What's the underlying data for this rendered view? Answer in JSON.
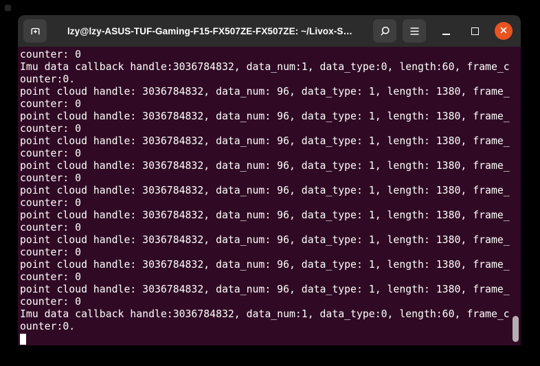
{
  "window": {
    "title": "lzy@lzy-ASUS-TUF-Gaming-F15-FX507ZE-FX507ZE: ~/Livox-S…",
    "titlebar": {
      "icons": {
        "left": "new-tab-icon",
        "right": [
          "search-icon",
          "menu-icon",
          "minimize-icon",
          "maximize-icon",
          "close-icon"
        ]
      }
    },
    "colors": {
      "titlebar_bg": "#2c2c2c",
      "titlebar_button_bg": "#3e3e3e",
      "close_button": "#e95420",
      "terminal_bg": "#300a24",
      "terminal_fg": "#ffffff",
      "scrollbar_thumb": "#b5aeb2",
      "surround": "#000000"
    }
  },
  "terminal": {
    "lines": [
      "counter: 0",
      "Imu data callback handle:3036784832, data_num:1, data_type:0, length:60, frame_c",
      "ounter:0.",
      "point cloud handle: 3036784832, data_num: 96, data_type: 1, length: 1380, frame_",
      "counter: 0",
      "point cloud handle: 3036784832, data_num: 96, data_type: 1, length: 1380, frame_",
      "counter: 0",
      "point cloud handle: 3036784832, data_num: 96, data_type: 1, length: 1380, frame_",
      "counter: 0",
      "point cloud handle: 3036784832, data_num: 96, data_type: 1, length: 1380, frame_",
      "counter: 0",
      "point cloud handle: 3036784832, data_num: 96, data_type: 1, length: 1380, frame_",
      "counter: 0",
      "point cloud handle: 3036784832, data_num: 96, data_type: 1, length: 1380, frame_",
      "counter: 0",
      "point cloud handle: 3036784832, data_num: 96, data_type: 1, length: 1380, frame_",
      "counter: 0",
      "point cloud handle: 3036784832, data_num: 96, data_type: 1, length: 1380, frame_",
      "counter: 0",
      "point cloud handle: 3036784832, data_num: 96, data_type: 1, length: 1380, frame_",
      "counter: 0",
      "Imu data callback handle:3036784832, data_num:1, data_type:0, length:60, frame_c",
      "ounter:0."
    ],
    "cursor_visible": true
  }
}
